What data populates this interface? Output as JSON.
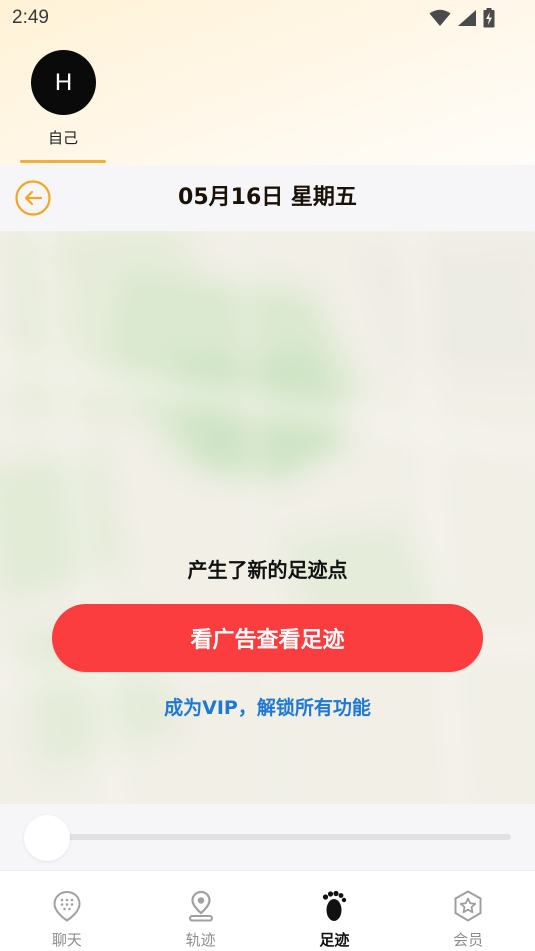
{
  "status_bar": {
    "time": "2:49"
  },
  "members": [
    {
      "initial": "H",
      "name": "自己"
    }
  ],
  "date_bar": {
    "title": "05月16日 星期五"
  },
  "map": {
    "notice": "产生了新的足迹点",
    "watch_ad_label": "看广告查看足迹",
    "vip_label": "成为VIP，解锁所有功能"
  },
  "slider": {
    "value": 0
  },
  "bottom_nav": [
    {
      "label": "聊天",
      "icon": "chat-pin-icon",
      "active": false
    },
    {
      "label": "轨迹",
      "icon": "location-pin-icon",
      "active": false
    },
    {
      "label": "足迹",
      "icon": "footprint-icon",
      "active": true
    },
    {
      "label": "会员",
      "icon": "vip-star-icon",
      "active": false
    }
  ],
  "colors": {
    "accent": "#f0b13a",
    "primary_button": "#fc3d3f",
    "link": "#1f78d1"
  }
}
